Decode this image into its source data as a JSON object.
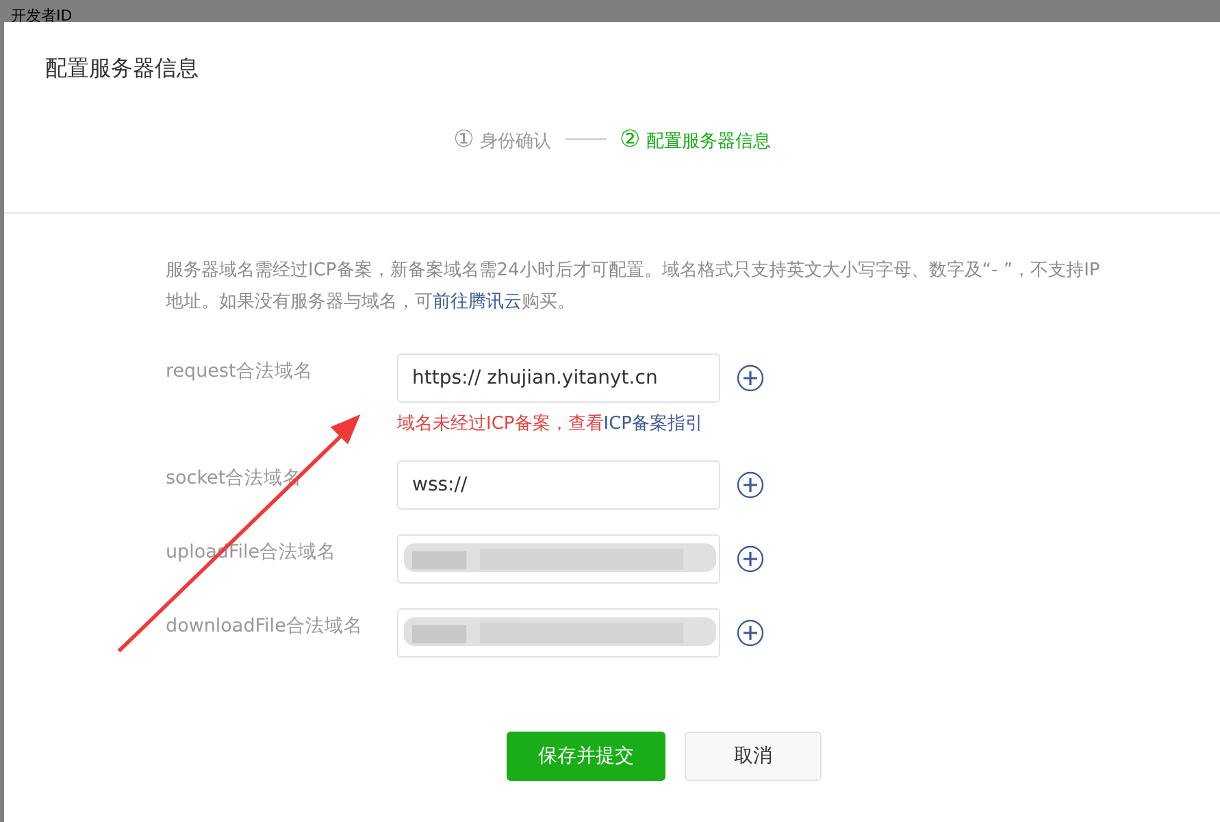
{
  "backdrop": {
    "text": "开发者ID"
  },
  "dialog": {
    "title": "配置服务器信息"
  },
  "steps": [
    {
      "number": "①",
      "label": "身份确认",
      "selected": false
    },
    {
      "number": "②",
      "label": "配置服务器信息",
      "selected": true
    }
  ],
  "notice": {
    "text": "服务器域名需经过ICP备案，新备案域名需24小时后才可配置。域名格式只支持英文大小写字母、数字及“- ”，不支持IP地址。如果没有服务器与域名，可",
    "link": "前往腾讯云",
    "after": "购买。"
  },
  "fields": [
    {
      "label": "request合法域名",
      "value": "https:// zhujian.yitanyt.cn",
      "redacted": false,
      "error": "域名未经过ICP备案，查看",
      "error_link": "ICP备案指引"
    },
    {
      "label": "socket合法域名",
      "value": "wss://",
      "redacted": false
    },
    {
      "label": "uploadFile合法域名",
      "redacted": true
    },
    {
      "label": "downloadFile合法域名",
      "redacted": true
    }
  ],
  "buttons": [
    {
      "label": "保存并提交",
      "kind": "primary"
    },
    {
      "label": "取消",
      "kind": "default"
    }
  ]
}
